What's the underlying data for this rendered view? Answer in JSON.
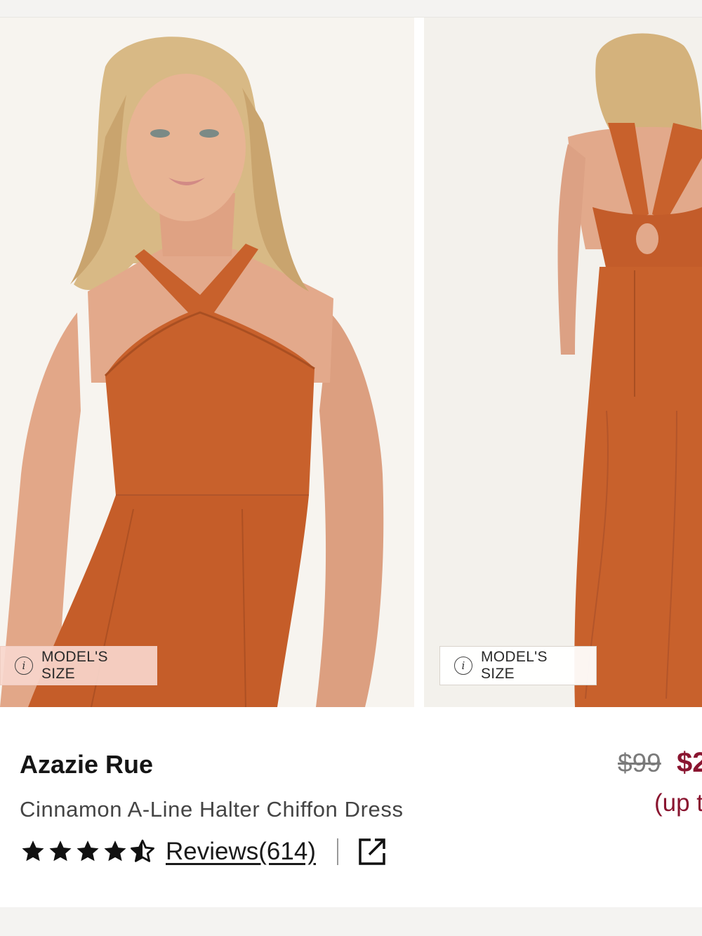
{
  "gallery": {
    "images": [
      {
        "view": "front",
        "badge_label": "MODEL'S SIZE",
        "badge_icon": "info-icon"
      },
      {
        "view": "back",
        "badge_label": "MODEL'S SIZE",
        "badge_icon": "info-icon"
      }
    ],
    "dress_color": "#c8612c"
  },
  "product": {
    "title": "Azazie Rue",
    "subtitle": "Cinnamon A-Line Halter Chiffon Dress",
    "rating": 4.5,
    "rating_max": 5,
    "reviews_label": "Reviews(614)",
    "share_icon": "external-link-icon"
  },
  "price": {
    "original": "$99",
    "current": "$2",
    "note": "(up t"
  },
  "colors": {
    "accent": "#8a1530",
    "text": "#1a1a1a",
    "muted": "#7a7a7a"
  }
}
